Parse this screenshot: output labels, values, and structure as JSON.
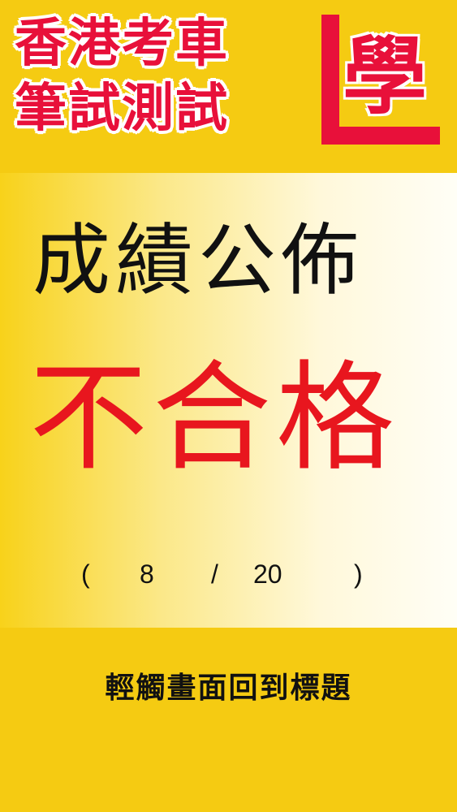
{
  "app": {
    "title_line1": "香港考車",
    "title_line2": "筆試測試",
    "logo_char": "學"
  },
  "result": {
    "heading": "成績公佈",
    "verdict": "不合格",
    "score_open": "(",
    "score_correct": "8",
    "score_separator": "/",
    "score_total": "20",
    "score_close": ")"
  },
  "footer": {
    "back_label": "輕觸畫面回到標題"
  },
  "colors": {
    "background_yellow": "#F5CB12",
    "accent_red": "#E8103A",
    "verdict_red": "#E8161E",
    "text_dark": "#111111"
  }
}
